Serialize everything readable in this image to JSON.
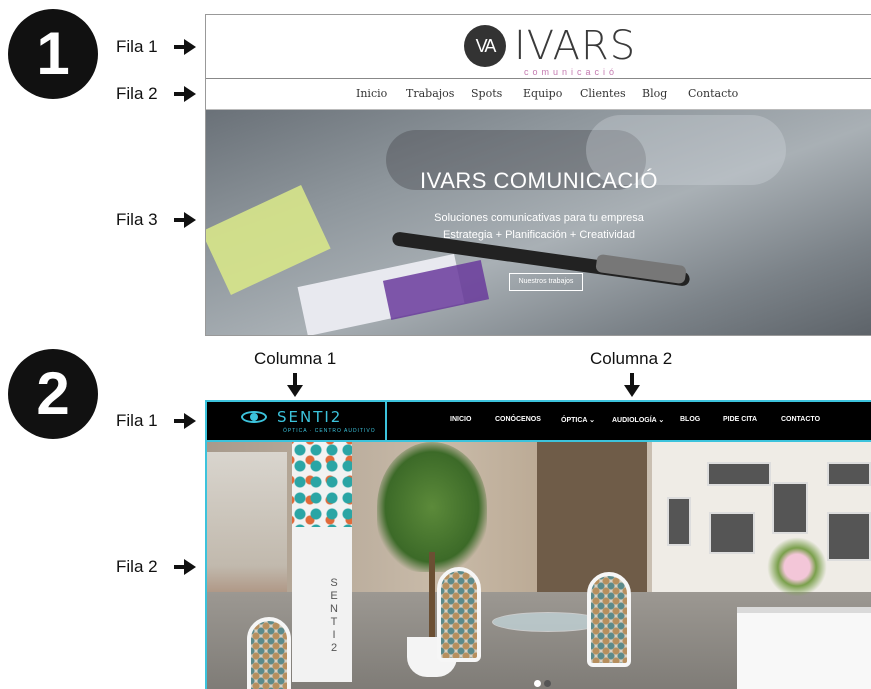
{
  "markers": {
    "one": "1",
    "two": "2"
  },
  "figure1": {
    "row_labels": [
      "Fila 1",
      "Fila 2",
      "Fila 3"
    ],
    "logo": {
      "mark": "VA",
      "name": "IVARS",
      "sub": "comunicació"
    },
    "nav": [
      "Inicio",
      "Trabajos",
      "Spots",
      "Equipo",
      "Clientes",
      "Blog",
      "Contacto"
    ],
    "hero": {
      "title": "IVARS COMUNICACIÓ",
      "subtitle_1": "Soluciones comunicativas para tu empresa",
      "subtitle_2": "Estrategia + Planificación + Creatividad",
      "button": "Nuestros trabajos"
    }
  },
  "figure2": {
    "column_labels": [
      "Columna 1",
      "Columna 2"
    ],
    "row_labels": [
      "Fila 1",
      "Fila 2"
    ],
    "logo": {
      "name": "SENTI2",
      "sub": "ÓPTICA · CENTRO AUDITIVO"
    },
    "nav": [
      "INICIO",
      "CONÓCENOS",
      "ÓPTICA ⌄",
      "AUDIOLOGÍA ⌄",
      "BLOG",
      "PIDE CITA",
      "CONTACTO"
    ],
    "column_text": "SENTI2",
    "accent_color": "#3cc3dc"
  }
}
